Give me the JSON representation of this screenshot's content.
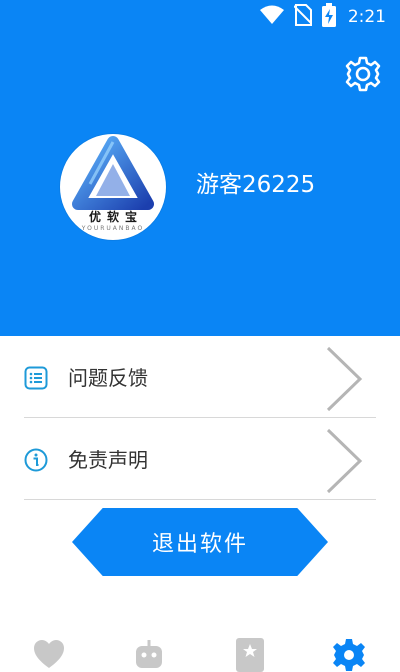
{
  "status_bar": {
    "time": "2:21",
    "icons": [
      "wifi-icon",
      "no-sim-icon",
      "battery-charging-icon"
    ]
  },
  "header": {
    "settings_icon": "gear-icon",
    "avatar": {
      "brand_text": "优软宝",
      "brand_sub": "YOURUANBAO"
    },
    "username": "游客26225",
    "background_color": "#0a85f5"
  },
  "menu": {
    "items": [
      {
        "label": "问题反馈",
        "icon": "list-icon"
      },
      {
        "label": "免责声明",
        "icon": "info-icon"
      }
    ]
  },
  "exit_button": {
    "label": "退出软件"
  },
  "bottom_nav": {
    "items": [
      {
        "icon": "heart-icon"
      },
      {
        "icon": "robot-icon"
      },
      {
        "icon": "star-card-icon"
      },
      {
        "icon": "gear-icon",
        "active": true
      }
    ],
    "active_color": "#0a85f5",
    "inactive_color": "#c8c8c8"
  }
}
